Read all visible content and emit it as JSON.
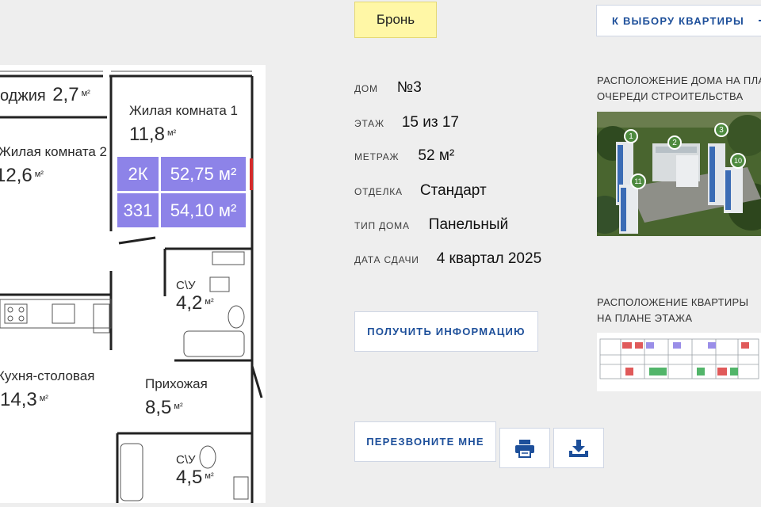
{
  "plan": {
    "rooms": {
      "loggia": {
        "name": "оджия",
        "area": "2,7",
        "unit": "м²"
      },
      "living1": {
        "name": "Жилая комната 1",
        "area": "11,8",
        "unit": "м²"
      },
      "living2": {
        "name": "Жилая комната 2",
        "area": "12,6",
        "unit": "м²"
      },
      "bath1": {
        "name": "С\\У",
        "area": "4,2",
        "unit": "м²"
      },
      "kitchen": {
        "name": "Кухня-столовая",
        "area": "14,3",
        "unit": "м²"
      },
      "hall": {
        "name": "Прихожая",
        "area": "8,5",
        "unit": "м²"
      },
      "bath2": {
        "name": "С\\У",
        "area": "4,5",
        "unit": "м²"
      }
    },
    "badge": {
      "type": "2К",
      "area1": "52,75 м²",
      "number": "331",
      "area2": "54,10 м²"
    }
  },
  "status": {
    "label": "Бронь"
  },
  "properties": [
    {
      "label": "ДОМ",
      "value": "№3"
    },
    {
      "label": "ЭТАЖ",
      "value": "15 из 17"
    },
    {
      "label": "МЕТРАЖ",
      "value": "52 м²"
    },
    {
      "label": "ОТДЕЛКА",
      "value": "Стандарт"
    },
    {
      "label": "ТИП ДОМА",
      "value": "Панельный"
    },
    {
      "label": "ДАТА СДАЧИ",
      "value": "4 квартал 2025"
    }
  ],
  "buttons": {
    "get_info": "ПОЛУЧИТЬ ИНФОРМАЦИЮ",
    "call_me": "ПЕРЕЗВОНИТЕ МНЕ",
    "back": "К ВЫБОРУ КВАРТИРЫ"
  },
  "icons": {
    "print": "printer-icon",
    "download": "download-icon",
    "back": "dash-icon"
  },
  "right": {
    "house_caption": [
      "РАСПОЛОЖЕНИЕ ДОМА НА ПЛА",
      "ОЧЕРЕДИ СТРОИТЕЛЬСТВА"
    ],
    "flat_caption": [
      "РАСПОЛОЖЕНИЕ КВАРТИРЫ",
      "НА ПЛАНЕ ЭТАЖА"
    ],
    "markers": [
      "1",
      "2",
      "3",
      "11",
      "10"
    ]
  },
  "colors": {
    "accent": "#1d4f9a",
    "status_bg": "#fff7a6",
    "badge": "#8d83e8",
    "marker": "#4d8a3e"
  }
}
